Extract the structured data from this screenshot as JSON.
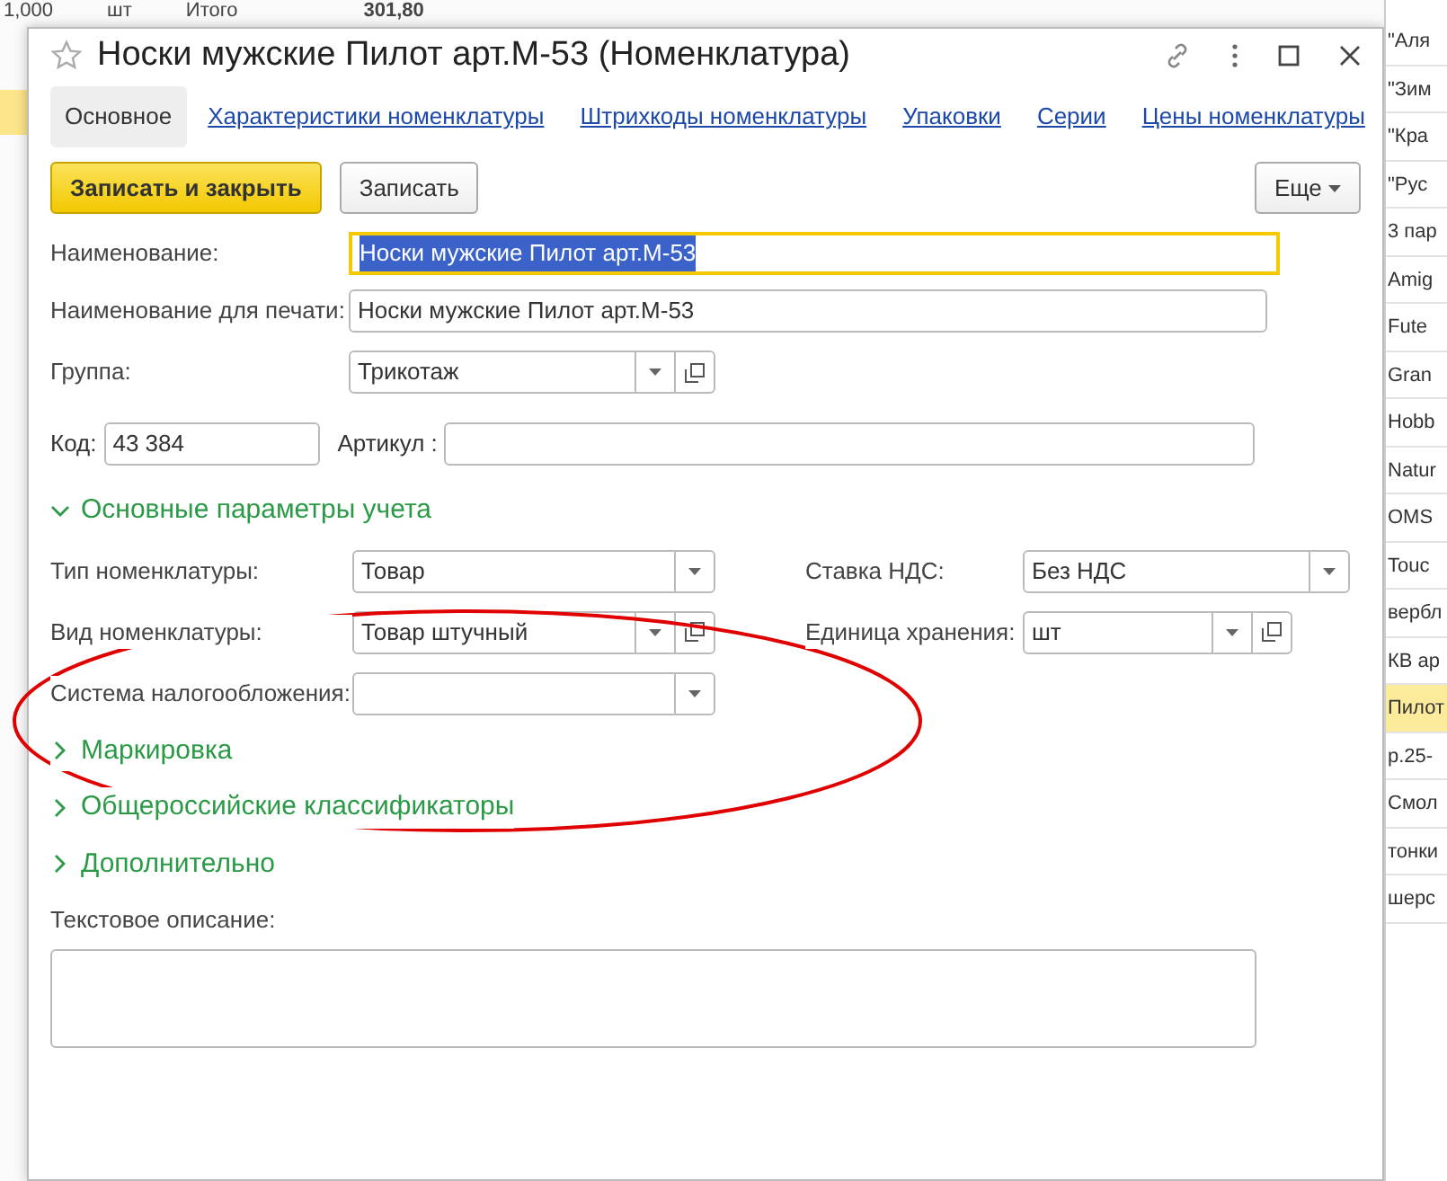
{
  "background": {
    "top_texts": [
      "1,000",
      "шт",
      "Итого",
      "301,80"
    ],
    "list": [
      {
        "text": "\"Аля",
        "selected": false
      },
      {
        "text": "\"Зим",
        "selected": false
      },
      {
        "text": "\"Кра",
        "selected": false
      },
      {
        "text": "\"Рус",
        "selected": false
      },
      {
        "text": "3 пар",
        "selected": false
      },
      {
        "text": "Amig",
        "selected": false
      },
      {
        "text": "Fute",
        "selected": false
      },
      {
        "text": "Gran",
        "selected": false
      },
      {
        "text": "Hobb",
        "selected": false
      },
      {
        "text": "Natur",
        "selected": false
      },
      {
        "text": "OMS",
        "selected": false
      },
      {
        "text": "Touc",
        "selected": false
      },
      {
        "text": "вербл",
        "selected": false
      },
      {
        "text": "КВ ар",
        "selected": false
      },
      {
        "text": "Пилот",
        "selected": true
      },
      {
        "text": "р.25-",
        "selected": false
      },
      {
        "text": "Смол",
        "selected": false
      },
      {
        "text": "тонки",
        "selected": false
      },
      {
        "text": "шерс",
        "selected": false
      }
    ]
  },
  "window": {
    "title": "Носки мужские Пилот арт.М-53 (Номенклатура)",
    "tabs": [
      {
        "label": "Основное",
        "selected": true
      },
      {
        "label": "Характеристики номенклатуры",
        "selected": false
      },
      {
        "label": "Штрихкоды номенклатуры",
        "selected": false
      },
      {
        "label": "Упаковки",
        "selected": false
      },
      {
        "label": "Серии",
        "selected": false
      },
      {
        "label": "Цены номенклатуры",
        "selected": false
      }
    ],
    "buttons": [
      {
        "label": "Записать и закрыть",
        "kind": "primary"
      },
      {
        "label": "Записать",
        "kind": "default"
      }
    ],
    "more_button": "Еще",
    "name_field": {
      "label": "Наименование:",
      "value": "Носки мужские Пилот арт.М-53",
      "focused": true
    },
    "print_name_field": {
      "label": "Наименование для печати:",
      "value": "Носки мужские Пилот арт.М-53",
      "focused": false
    },
    "group_field": {
      "label": "Группа:",
      "value": "Трикотаж",
      "open_button": true
    },
    "code_field": {
      "label": "Код:",
      "value": "43 384"
    },
    "article_field": {
      "label": "Артикул :"
    },
    "sections": [
      {
        "title": "Основные параметры учета",
        "expanded": true,
        "rows": [
          {
            "left": {
              "label": "Тип номенклатуры:",
              "value": "Товар",
              "open_button": false
            },
            "right": {
              "label": "Ставка НДС:",
              "value": "Без НДС",
              "open_button": false
            }
          },
          {
            "left": {
              "label": "Вид номенклатуры:",
              "value": "Товар штучный",
              "open_button": true
            },
            "right": {
              "label": "Единица хранения:",
              "value": "шт",
              "open_button": true
            }
          },
          {
            "left": {
              "label": "Система налогообложения:",
              "open_button": false
            }
          }
        ]
      },
      {
        "title": "Маркировка",
        "expanded": false
      },
      {
        "title": "Общероссийские классификаторы",
        "expanded": false
      },
      {
        "title": "Дополнительно",
        "expanded": false
      }
    ],
    "description": {
      "label": "Текстовое описание:"
    }
  }
}
